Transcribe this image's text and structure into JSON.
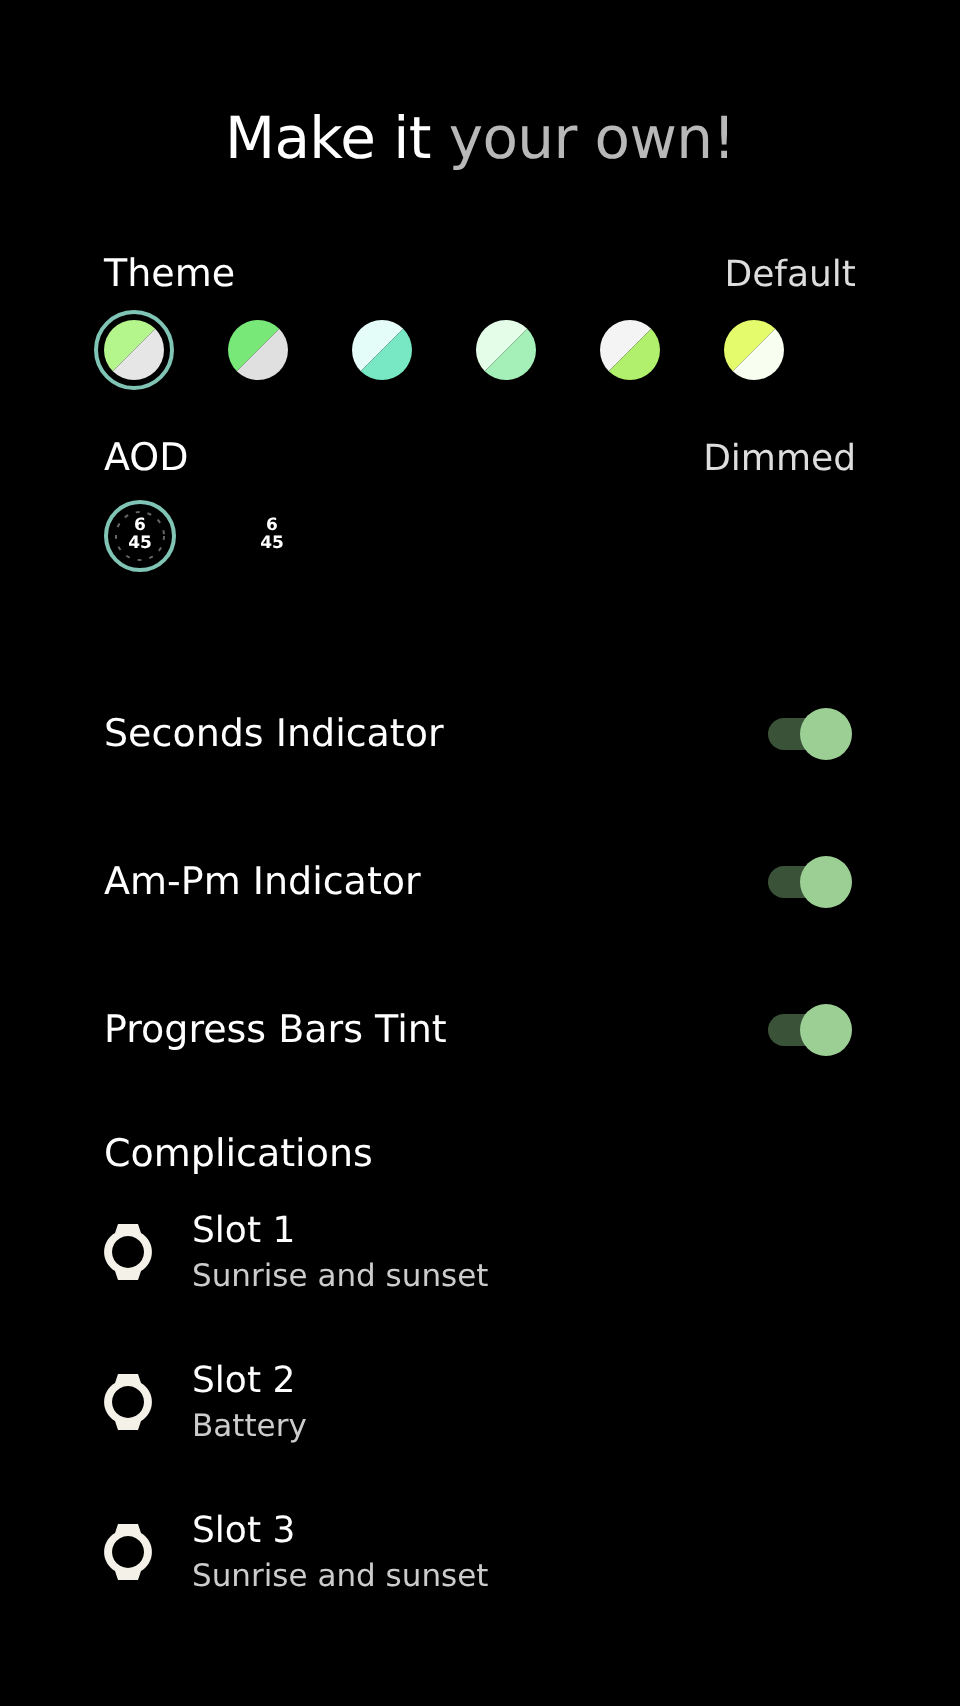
{
  "title": "Make it **your own!**",
  "theme": {
    "label": "Theme",
    "value": "Default",
    "swatches": [
      {
        "halves": [
          {
            "color": "#b4f58c"
          },
          {
            "color": "#e6e6e6"
          }
        ],
        "selected": true
      },
      {
        "halves": [
          {
            "color": "#78e878"
          },
          {
            "color": "#e0e0e0"
          }
        ],
        "selected": false
      },
      {
        "halves": [
          {
            "color": "#e4fdf8"
          },
          {
            "color": "#78e8c4"
          }
        ],
        "selected": false
      },
      {
        "halves": [
          {
            "color": "#e4fde8"
          },
          {
            "color": "#a4f0b8"
          }
        ],
        "selected": false
      },
      {
        "halves": [
          {
            "color": "#f4f4f4"
          },
          {
            "color": "#b0f06c"
          }
        ],
        "selected": false
      },
      {
        "halves": [
          {
            "color": "#e4fc6c"
          },
          {
            "color": "#f8fff0"
          }
        ],
        "selected": false
      }
    ]
  },
  "aod": {
    "label": "AOD",
    "value": "Dimmed",
    "options": [
      {
        "kind": "full",
        "hour": "6",
        "minute": "45",
        "selected": true
      },
      {
        "kind": "minimal",
        "hour": "6",
        "minute": "45",
        "selected": false
      }
    ]
  },
  "toggles": [
    {
      "label": "Seconds Indicator",
      "on": true
    },
    {
      "label": "Am-Pm Indicator",
      "on": true
    },
    {
      "label": "Progress Bars Tint",
      "on": true
    }
  ],
  "complications": {
    "label": "Complications",
    "slots": [
      {
        "title": "Slot 1",
        "subtitle": "Sunrise and sunset"
      },
      {
        "title": "Slot 2",
        "subtitle": "Battery"
      },
      {
        "title": "Slot 3",
        "subtitle": "Sunrise and sunset"
      }
    ]
  }
}
